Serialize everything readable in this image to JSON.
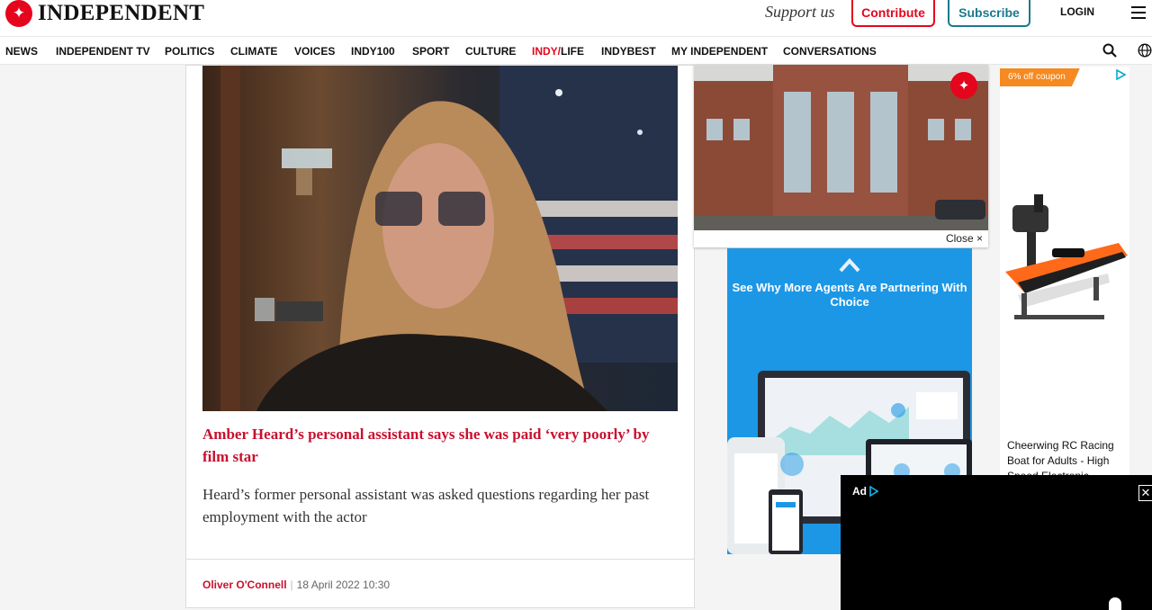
{
  "header": {
    "logo_text": "INDEPENDENT",
    "support_text": "Support us",
    "contribute_label": "Contribute",
    "subscribe_label": "Subscribe",
    "login_label": "LOGIN"
  },
  "nav": {
    "items": [
      "NEWS",
      "INDEPENDENT TV",
      "POLITICS",
      "CLIMATE",
      "VOICES",
      "INDY100",
      "SPORT",
      "CULTURE",
      "INDY/LIFE",
      "INDYBEST",
      "MY INDEPENDENT",
      "CONVERSATIONS"
    ],
    "indylife_prefix": "INDY/",
    "indylife_suffix": "LIFE"
  },
  "article": {
    "headline": "Amber Heard’s personal assistant says she was paid ‘very poorly’ by film star",
    "summary": "Heard’s former personal assistant was asked questions regarding her past employment with the actor",
    "author": "Oliver O'Connell",
    "date": "18 April 2022 10:30"
  },
  "floating_video": {
    "close_label": "Close ×"
  },
  "ads": {
    "blue_ad_text": "See Why More Agents Are Partnering With Choice",
    "coupon": "6% off coupon",
    "product_title": "Cheerwing RC Racing Boat for Adults - High Speed Electronic",
    "bottom_ad_label": "Ad"
  },
  "colors": {
    "brand_red": "#e5051c",
    "headline_red": "#c8102e",
    "subscribe_teal": "#1a7a8c",
    "ad_blue": "#1c97e6",
    "coupon_orange": "#f6891f"
  },
  "icons": [
    "independent-eagle-icon",
    "hamburger-menu-icon",
    "search-icon",
    "globe-icon",
    "chevron-up-icon",
    "adchoices-icon",
    "close-icon",
    "play-triangle-icon"
  ]
}
